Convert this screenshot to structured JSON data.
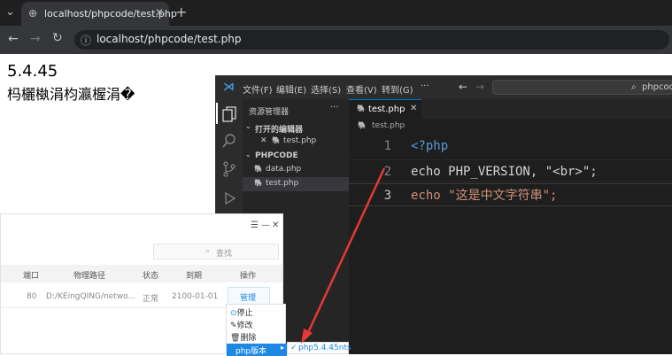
{
  "browser": {
    "tab_title": "localhost/phpcode/test.php",
    "url": "localhost/phpcode/test.php"
  },
  "page": {
    "version_text": "5.4.45",
    "garbled_text": "杩欐槸涓枃瀛楃涓�"
  },
  "vscode": {
    "menu": [
      "文件(F)",
      "编辑(E)",
      "选择(S)",
      "查看(V)",
      "转到(G)",
      "···"
    ],
    "search_placeholder": "phpcode",
    "explorer_title": "资源管理器",
    "open_editors_label": "打开的编辑器",
    "open_file": "test.php",
    "folder_name": "PHPCODE",
    "files": [
      "data.php",
      "test.php"
    ],
    "editor_tab": "test.php",
    "breadcrumb": "test.php",
    "code_lines": [
      {
        "num": "1",
        "text": "<?php"
      },
      {
        "num": "2",
        "text": "echo PHP_VERSION, \"<br>\";"
      },
      {
        "num": "3",
        "text": "echo \"这是中文字符串\";"
      }
    ]
  },
  "panel": {
    "window_controls": [
      "☰",
      "—",
      "✕"
    ],
    "search_placeholder": "查找",
    "columns": [
      "端口",
      "物理路径",
      "状态",
      "到期",
      "操作"
    ],
    "row": {
      "port": "80",
      "path": "D:/KEingQING/netwo...",
      "status": "正常",
      "expiry": "2100-01-01",
      "action": "管理"
    },
    "context_menu": [
      "停止",
      "修改",
      "删除",
      "php版本"
    ],
    "submenu_item": "php5.4.45nts"
  },
  "colors": {
    "accent": "#1e88e5",
    "annotation_arrow": "#e53935"
  }
}
